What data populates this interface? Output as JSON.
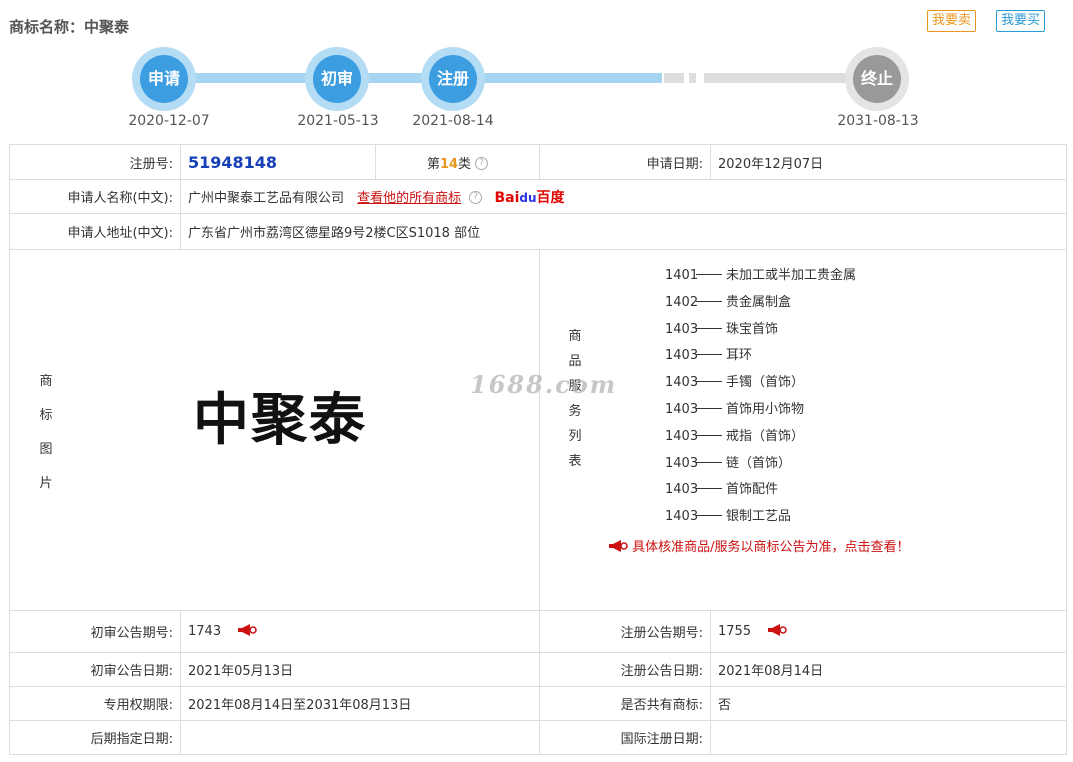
{
  "header": {
    "title": "商标名称：中聚泰",
    "sell_label": "我要卖",
    "buy_label": "我要买"
  },
  "timeline": {
    "stages": [
      {
        "label": "申请",
        "date": "2020-12-07"
      },
      {
        "label": "初审",
        "date": "2021-05-13"
      },
      {
        "label": "注册",
        "date": "2021-08-14"
      },
      {
        "label": "终止",
        "date": "2031-08-13"
      }
    ],
    "colors": {
      "done": "#3d9de1",
      "done_ring": "#b5dcf5",
      "track_done": "#a6d5f2",
      "pending": "#999999",
      "track_pending": "#dddddd"
    }
  },
  "info": {
    "reg_no_label": "注册号:",
    "reg_no": "51948148",
    "class_prefix": "第",
    "class_num": "14",
    "class_suffix": "类",
    "app_date_label": "申请日期:",
    "app_date": "2020年12月07日",
    "applicant_label": "申请人名称(中文):",
    "applicant": "广州中聚泰工艺品有限公司",
    "all_marks_link": "查看他的所有商标",
    "baidu_a": "Bai",
    "baidu_b": "du",
    "baidu_c": "百度",
    "address_label": "申请人地址(中文):",
    "address": "广东省广州市荔湾区德星路9号2楼C区S1018 部位",
    "image_label": [
      "商",
      "标",
      "图",
      "片"
    ],
    "mark_text": "中聚泰",
    "watermark": "1688.com",
    "goods_label": [
      "商",
      "品",
      "服",
      "务",
      "列",
      "表"
    ],
    "goods": [
      {
        "code": "1401",
        "name": "未加工或半加工贵金属"
      },
      {
        "code": "1402",
        "name": "贵金属制盒"
      },
      {
        "code": "1403",
        "name": "珠宝首饰"
      },
      {
        "code": "1403",
        "name": "耳环"
      },
      {
        "code": "1403",
        "name": "手镯（首饰）"
      },
      {
        "code": "1403",
        "name": "首饰用小饰物"
      },
      {
        "code": "1403",
        "name": "戒指（首饰）"
      },
      {
        "code": "1403",
        "name": "链（首饰）"
      },
      {
        "code": "1403",
        "name": "首饰配件"
      },
      {
        "code": "1403",
        "name": "银制工艺品"
      }
    ],
    "goods_notice": "具体核准商品/服务以商标公告为准，点击查看！",
    "prelim_no_label": "初审公告期号:",
    "prelim_no": "1743",
    "reg_ann_no_label": "注册公告期号:",
    "reg_ann_no": "1755",
    "prelim_date_label": "初审公告日期:",
    "prelim_date": "2021年05月13日",
    "reg_ann_date_label": "注册公告日期:",
    "reg_ann_date": "2021年08月14日",
    "exclusive_label": "专用权期限:",
    "exclusive": "2021年08月14日至2031年08月13日",
    "shared_label": "是否共有商标:",
    "shared": "否",
    "later_label": "后期指定日期:",
    "later": "",
    "intl_label": "国际注册日期:",
    "intl": ""
  }
}
